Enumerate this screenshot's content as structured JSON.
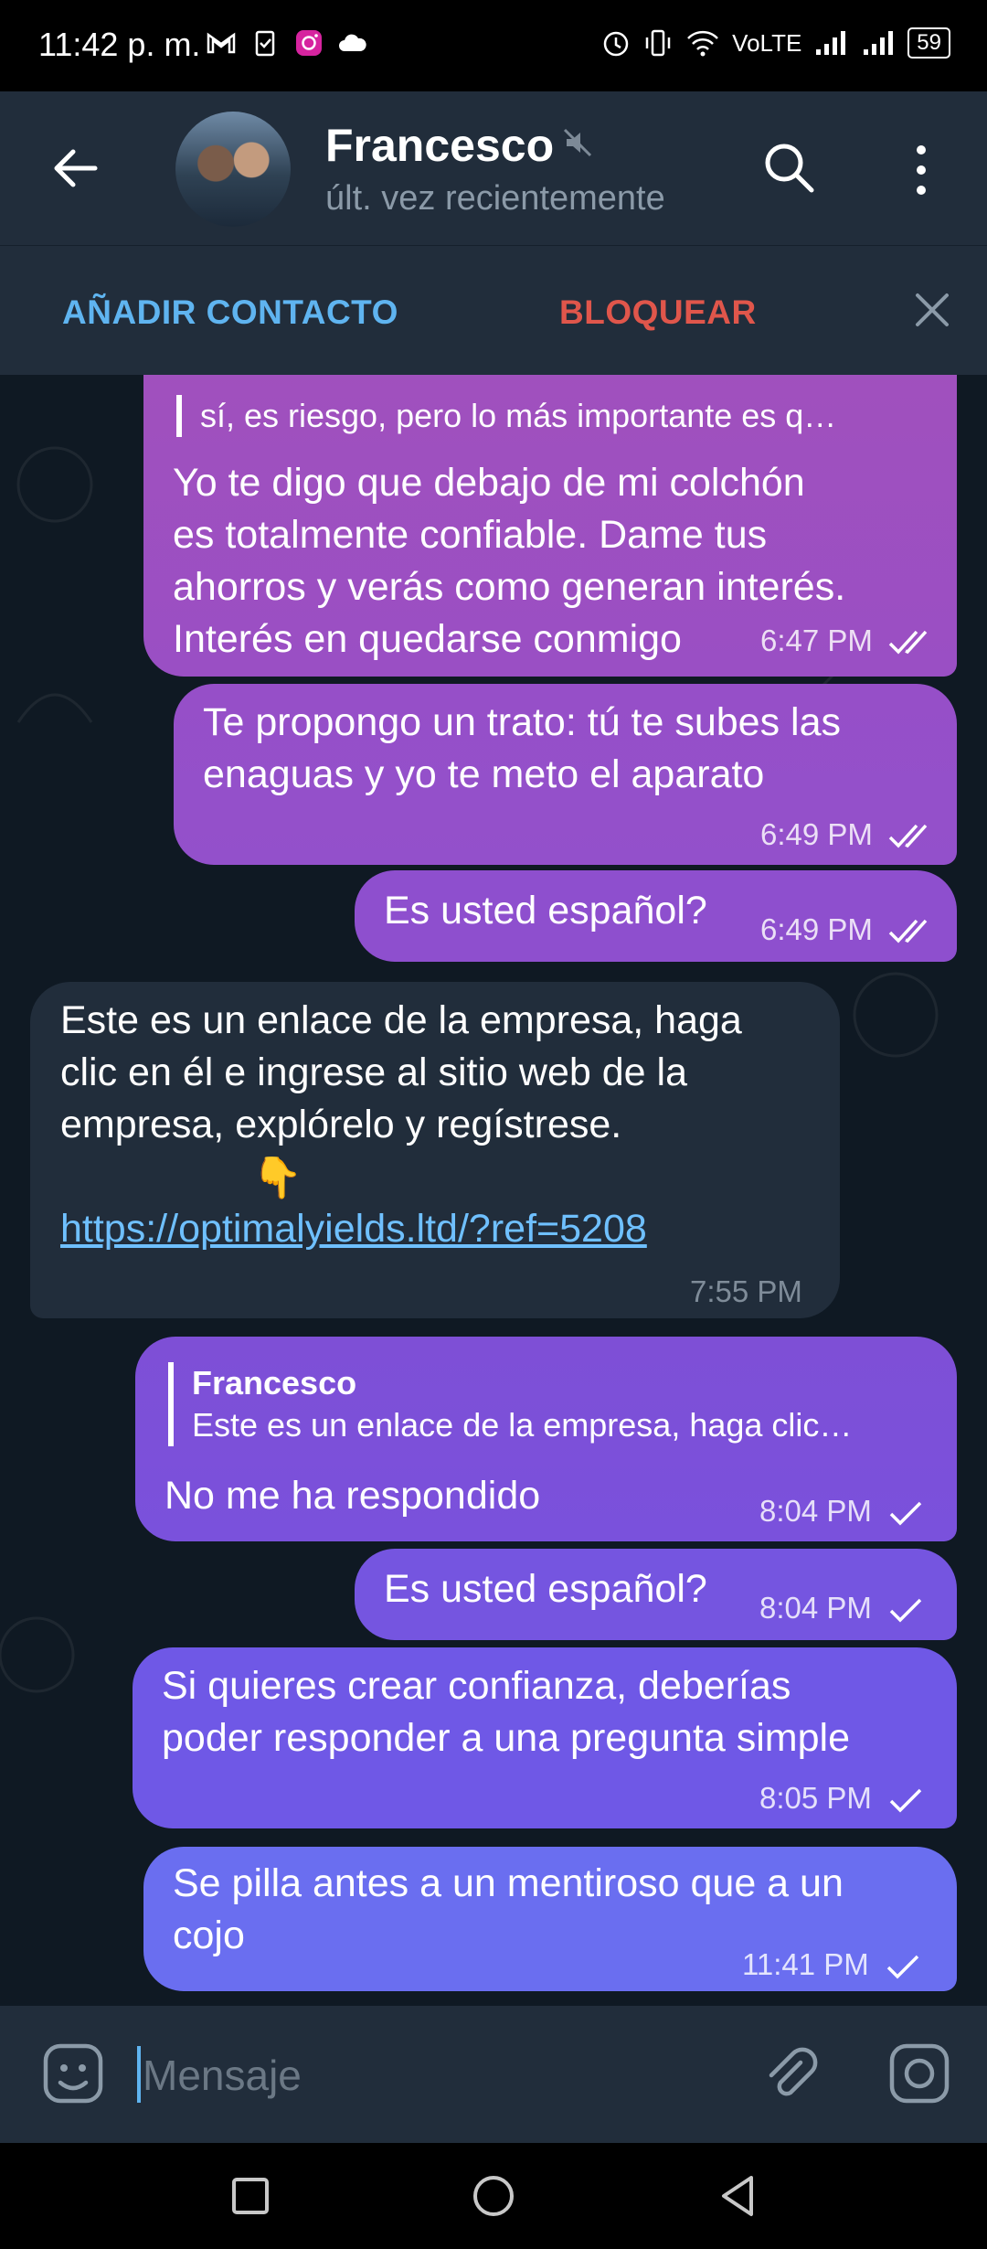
{
  "status_bar": {
    "time": "11:42 p. m.",
    "network": "VoLTE",
    "battery": "59"
  },
  "header": {
    "name": "Francesco",
    "status": "últ. vez recientemente"
  },
  "actions": {
    "add_contact": "AÑADIR CONTACTO",
    "block": "BLOQUEAR"
  },
  "messages": [
    {
      "id": 1,
      "direction": "out",
      "reply_text": "sí, es riesgo, pero lo más importante es q…",
      "lines": [
        "Yo te digo que debajo de mi colchón",
        "es totalmente confiable. Dame tus",
        "ahorros y verás como generan interés.",
        "Interés en quedarse conmigo"
      ],
      "time": "6:47 PM",
      "status": "read"
    },
    {
      "id": 2,
      "direction": "out",
      "lines": [
        "Te propongo un trato: tú te subes las",
        "enaguas y yo te meto el aparato"
      ],
      "time": "6:49 PM",
      "status": "read"
    },
    {
      "id": 3,
      "direction": "out",
      "lines": [
        "Es usted español?"
      ],
      "time": "6:49 PM",
      "status": "read"
    },
    {
      "id": 4,
      "direction": "in",
      "lines": [
        "Este es un enlace de la empresa, haga",
        "clic en él e ingrese al sitio web de la",
        "empresa, explórelo y regístrese."
      ],
      "emoji": "👇",
      "link": "https://optimalyields.ltd/?ref=5208",
      "time": "7:55 PM"
    },
    {
      "id": 5,
      "direction": "out",
      "reply_name": "Francesco",
      "reply_text": "Este es un enlace de la empresa, haga clic…",
      "lines": [
        "No me ha respondido"
      ],
      "time": "8:04 PM",
      "status": "sent"
    },
    {
      "id": 6,
      "direction": "out",
      "lines": [
        "Es usted español?"
      ],
      "time": "8:04 PM",
      "status": "sent"
    },
    {
      "id": 7,
      "direction": "out",
      "lines": [
        "Si quieres crear confianza, deberías",
        "poder responder a una pregunta simple"
      ],
      "time": "8:05 PM",
      "status": "sent"
    },
    {
      "id": 8,
      "direction": "out",
      "lines": [
        "Se pilla antes a un mentiroso que a un",
        "cojo"
      ],
      "time": "11:41 PM",
      "status": "sent"
    }
  ],
  "input": {
    "placeholder": "Mensaje"
  },
  "colors": {
    "accent": "#5fb4f0",
    "danger": "#e0564b",
    "header_bg": "#212d3b",
    "out_top": "#9a4fc0",
    "out_bottom": "#6a6ef0"
  }
}
